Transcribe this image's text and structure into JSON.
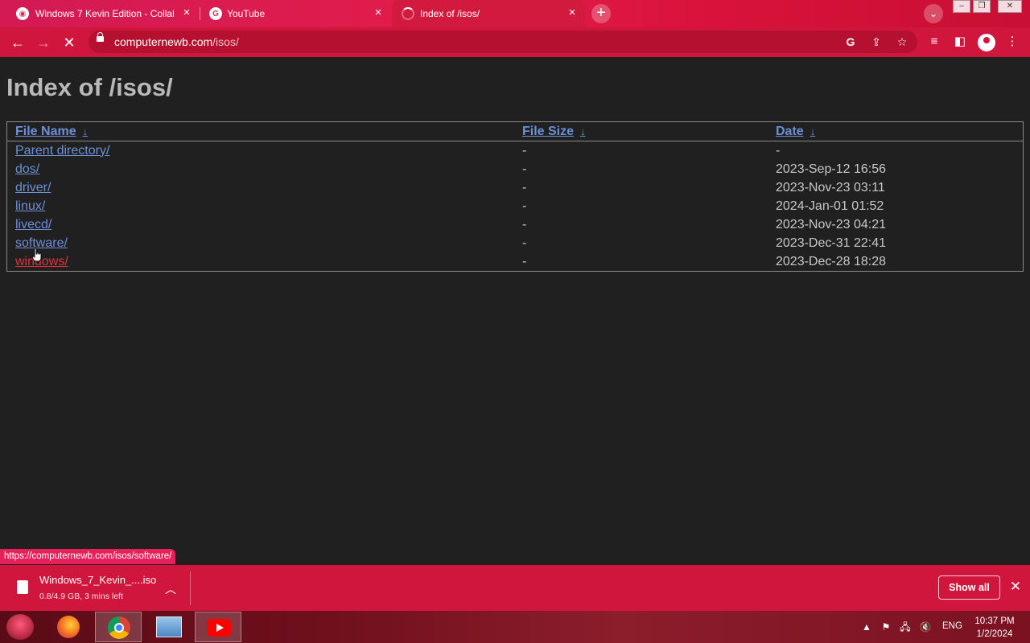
{
  "browser": {
    "tabs": [
      {
        "title": "Windows 7 Kevin Edition - Collab",
        "active": false
      },
      {
        "title": "YouTube",
        "active": false
      },
      {
        "title": "Index of /isos/",
        "active": true,
        "loading": true
      }
    ],
    "url_domain": "computernewb.com",
    "url_path": "/isos/",
    "status_url": "https://computernewb.com/isos/software/"
  },
  "page": {
    "heading": "Index of /isos/",
    "columns": {
      "name": "File Name",
      "size": "File Size",
      "date": "Date",
      "sort_arrow": "↓"
    },
    "rows": [
      {
        "name": "Parent directory/",
        "size": "-",
        "date": "-"
      },
      {
        "name": "dos/",
        "size": "-",
        "date": "2023-Sep-12 16:56"
      },
      {
        "name": "driver/",
        "size": "-",
        "date": "2023-Nov-23 03:11"
      },
      {
        "name": "linux/",
        "size": "-",
        "date": "2024-Jan-01 01:52"
      },
      {
        "name": "livecd/",
        "size": "-",
        "date": "2023-Nov-23 04:21"
      },
      {
        "name": "software/",
        "size": "-",
        "date": "2023-Dec-31 22:41"
      },
      {
        "name": "windows/",
        "size": "-",
        "date": "2023-Dec-28 18:28"
      }
    ]
  },
  "downloads": {
    "file_name": "Windows_7_Kevin_....iso",
    "status": "0.8/4.9 GB, 3 mins left",
    "show_all": "Show all"
  },
  "taskbar": {
    "language": "ENG",
    "time": "10:37 PM",
    "date": "1/2/2024"
  },
  "colors": {
    "accent": "#d0163d",
    "link": "#6d8fd7",
    "link_active": "#e0323c",
    "page_bg": "#202020"
  }
}
